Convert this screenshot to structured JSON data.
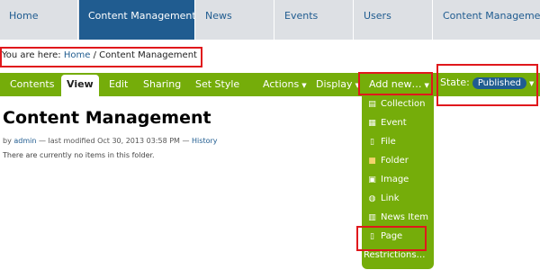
{
  "top_nav": [
    "Home",
    "Content Management",
    "News",
    "Events",
    "Users",
    "Content Management"
  ],
  "breadcrumb": {
    "prefix": "You are here:",
    "home": "Home",
    "separator": "/",
    "current": "Content Management"
  },
  "edit_bar": {
    "tabs": [
      "Contents",
      "View",
      "Edit",
      "Sharing",
      "Set Style"
    ],
    "actions": "Actions",
    "display": "Display",
    "add_new": "Add new…",
    "state_label": "State:",
    "state_value": "Published",
    "dropdown_arrow": "▼"
  },
  "page": {
    "title": "Content Management",
    "byline_prefix": "by",
    "author": "admin",
    "modified": "— last modified Oct 30, 2013 03:58 PM —",
    "history": "History",
    "empty_message": "There are currently no items in this folder."
  },
  "add_menu": [
    {
      "label": "Collection",
      "icon": "collection-icon"
    },
    {
      "label": "Event",
      "icon": "event-icon"
    },
    {
      "label": "File",
      "icon": "file-icon"
    },
    {
      "label": "Folder",
      "icon": "folder-icon"
    },
    {
      "label": "Image",
      "icon": "image-icon"
    },
    {
      "label": "Link",
      "icon": "link-icon"
    },
    {
      "label": "News Item",
      "icon": "news-item-icon"
    },
    {
      "label": "Page",
      "icon": "page-icon"
    },
    {
      "label": "Restrictions…",
      "icon": ""
    }
  ],
  "colors": {
    "nav_bg": "#dde0e4",
    "nav_selected": "#205c90",
    "edit_bar": "#75ad0a",
    "highlight": "#e0181c"
  }
}
